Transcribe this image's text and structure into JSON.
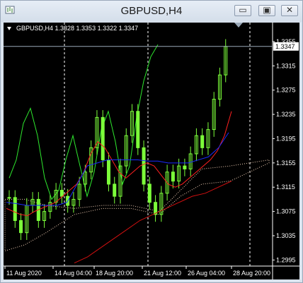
{
  "window": {
    "title": "GBPUSD,H4",
    "controls": {
      "minimize": "▭",
      "restore": "▣",
      "close": "✕"
    }
  },
  "chart": {
    "header": "GBPUSD,H4  1.3328 1.3353 1.3322 1.3347",
    "current_price": "1.3347",
    "y_ticks": [
      "1.3355",
      "1.3315",
      "1.3275",
      "1.3235",
      "1.3195",
      "1.3155",
      "1.3115",
      "1.3075",
      "1.3035",
      "1.2995"
    ],
    "x_ticks": [
      "11 Aug 2020",
      "14 Aug 04:00",
      "18 Aug 20:00",
      "21 Aug 12:00",
      "26 Aug 04:00",
      "28 Aug 20:00"
    ]
  },
  "chart_data": {
    "type": "candlestick",
    "symbol": "GBPUSD",
    "timeframe": "H4",
    "ylim": [
      1.2985,
      1.337
    ],
    "colors": {
      "candles": "#7cff3a",
      "ma_fast": "#ff2020",
      "ma_mid": "#1a2bff",
      "ma_slow": "#d01010",
      "chikou": "#2ee82e",
      "cloud": "#f5d2b8"
    },
    "closes": [
      1.3098,
      1.306,
      1.304,
      1.3085,
      1.3095,
      1.306,
      1.3075,
      1.309,
      1.311,
      1.31,
      1.3085,
      1.3095,
      1.312,
      1.314,
      1.318,
      1.323,
      1.316,
      1.312,
      1.31,
      1.315,
      1.32,
      1.324,
      1.318,
      1.312,
      1.309,
      1.307,
      1.3105,
      1.314,
      1.3125,
      1.315,
      1.3145,
      1.317,
      1.32,
      1.318,
      1.321,
      1.326,
      1.33,
      1.3347
    ],
    "ma_fast": [
      1.308,
      1.3075,
      1.307,
      1.3068,
      1.3075,
      1.308,
      1.3085,
      1.309,
      1.31,
      1.311,
      1.312,
      1.314,
      1.317,
      1.319,
      1.318,
      1.316,
      1.314,
      1.313,
      1.314,
      1.315,
      1.3155,
      1.315,
      1.3135,
      1.312,
      1.3115,
      1.312,
      1.313,
      1.314,
      1.315,
      1.316,
      1.3175,
      1.32,
      1.324
    ],
    "ma_mid": [
      1.309,
      1.3088,
      1.3085,
      1.3085,
      1.3085,
      1.3085,
      1.309,
      1.312,
      1.315,
      1.3155,
      1.316,
      1.316,
      1.316,
      1.316,
      1.3158,
      1.3158,
      1.3155,
      1.3155,
      1.3155,
      1.316,
      1.3165,
      1.318,
      1.3205
    ],
    "ma_slow": [
      1.299,
      1.3,
      1.3015,
      1.303,
      1.3045,
      1.306,
      1.307,
      1.308,
      1.309,
      1.31,
      1.3105,
      1.3115,
      1.3125
    ]
  }
}
